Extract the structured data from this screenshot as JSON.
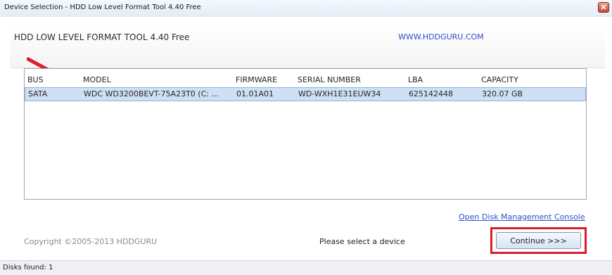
{
  "window": {
    "title": "Device Selection - HDD Low Level Format Tool 4.40   Free",
    "close_icon": "close-icon"
  },
  "header": {
    "app_name": "HDD LOW LEVEL FORMAT TOOL 4.40   Free",
    "website": "WWW.HDDGURU.COM"
  },
  "table": {
    "columns": {
      "bus": "BUS",
      "model": "MODEL",
      "firmware": "FIRMWARE",
      "serial": "SERIAL NUMBER",
      "lba": "LBA",
      "capacity": "CAPACITY"
    },
    "rows": [
      {
        "bus": "SATA",
        "model": "WDC WD3200BEVT-75A23T0 (C: ...",
        "firmware": "01.01A01",
        "serial": "WD-WXH1E31EUW34",
        "lba": "625142448",
        "capacity": "320.07 GB"
      }
    ]
  },
  "links": {
    "disk_management": "Open Disk Management Console"
  },
  "footer": {
    "copyright": "Copyright ©2005-2013 HDDGURU",
    "status_message": "Please select a device",
    "continue_label": "Continue >>>"
  },
  "statusbar": {
    "disks_found": "Disks found: 1"
  },
  "colors": {
    "link": "#2c4fc4",
    "selected_row": "#cfe0f4",
    "highlight": "#d9202a"
  }
}
